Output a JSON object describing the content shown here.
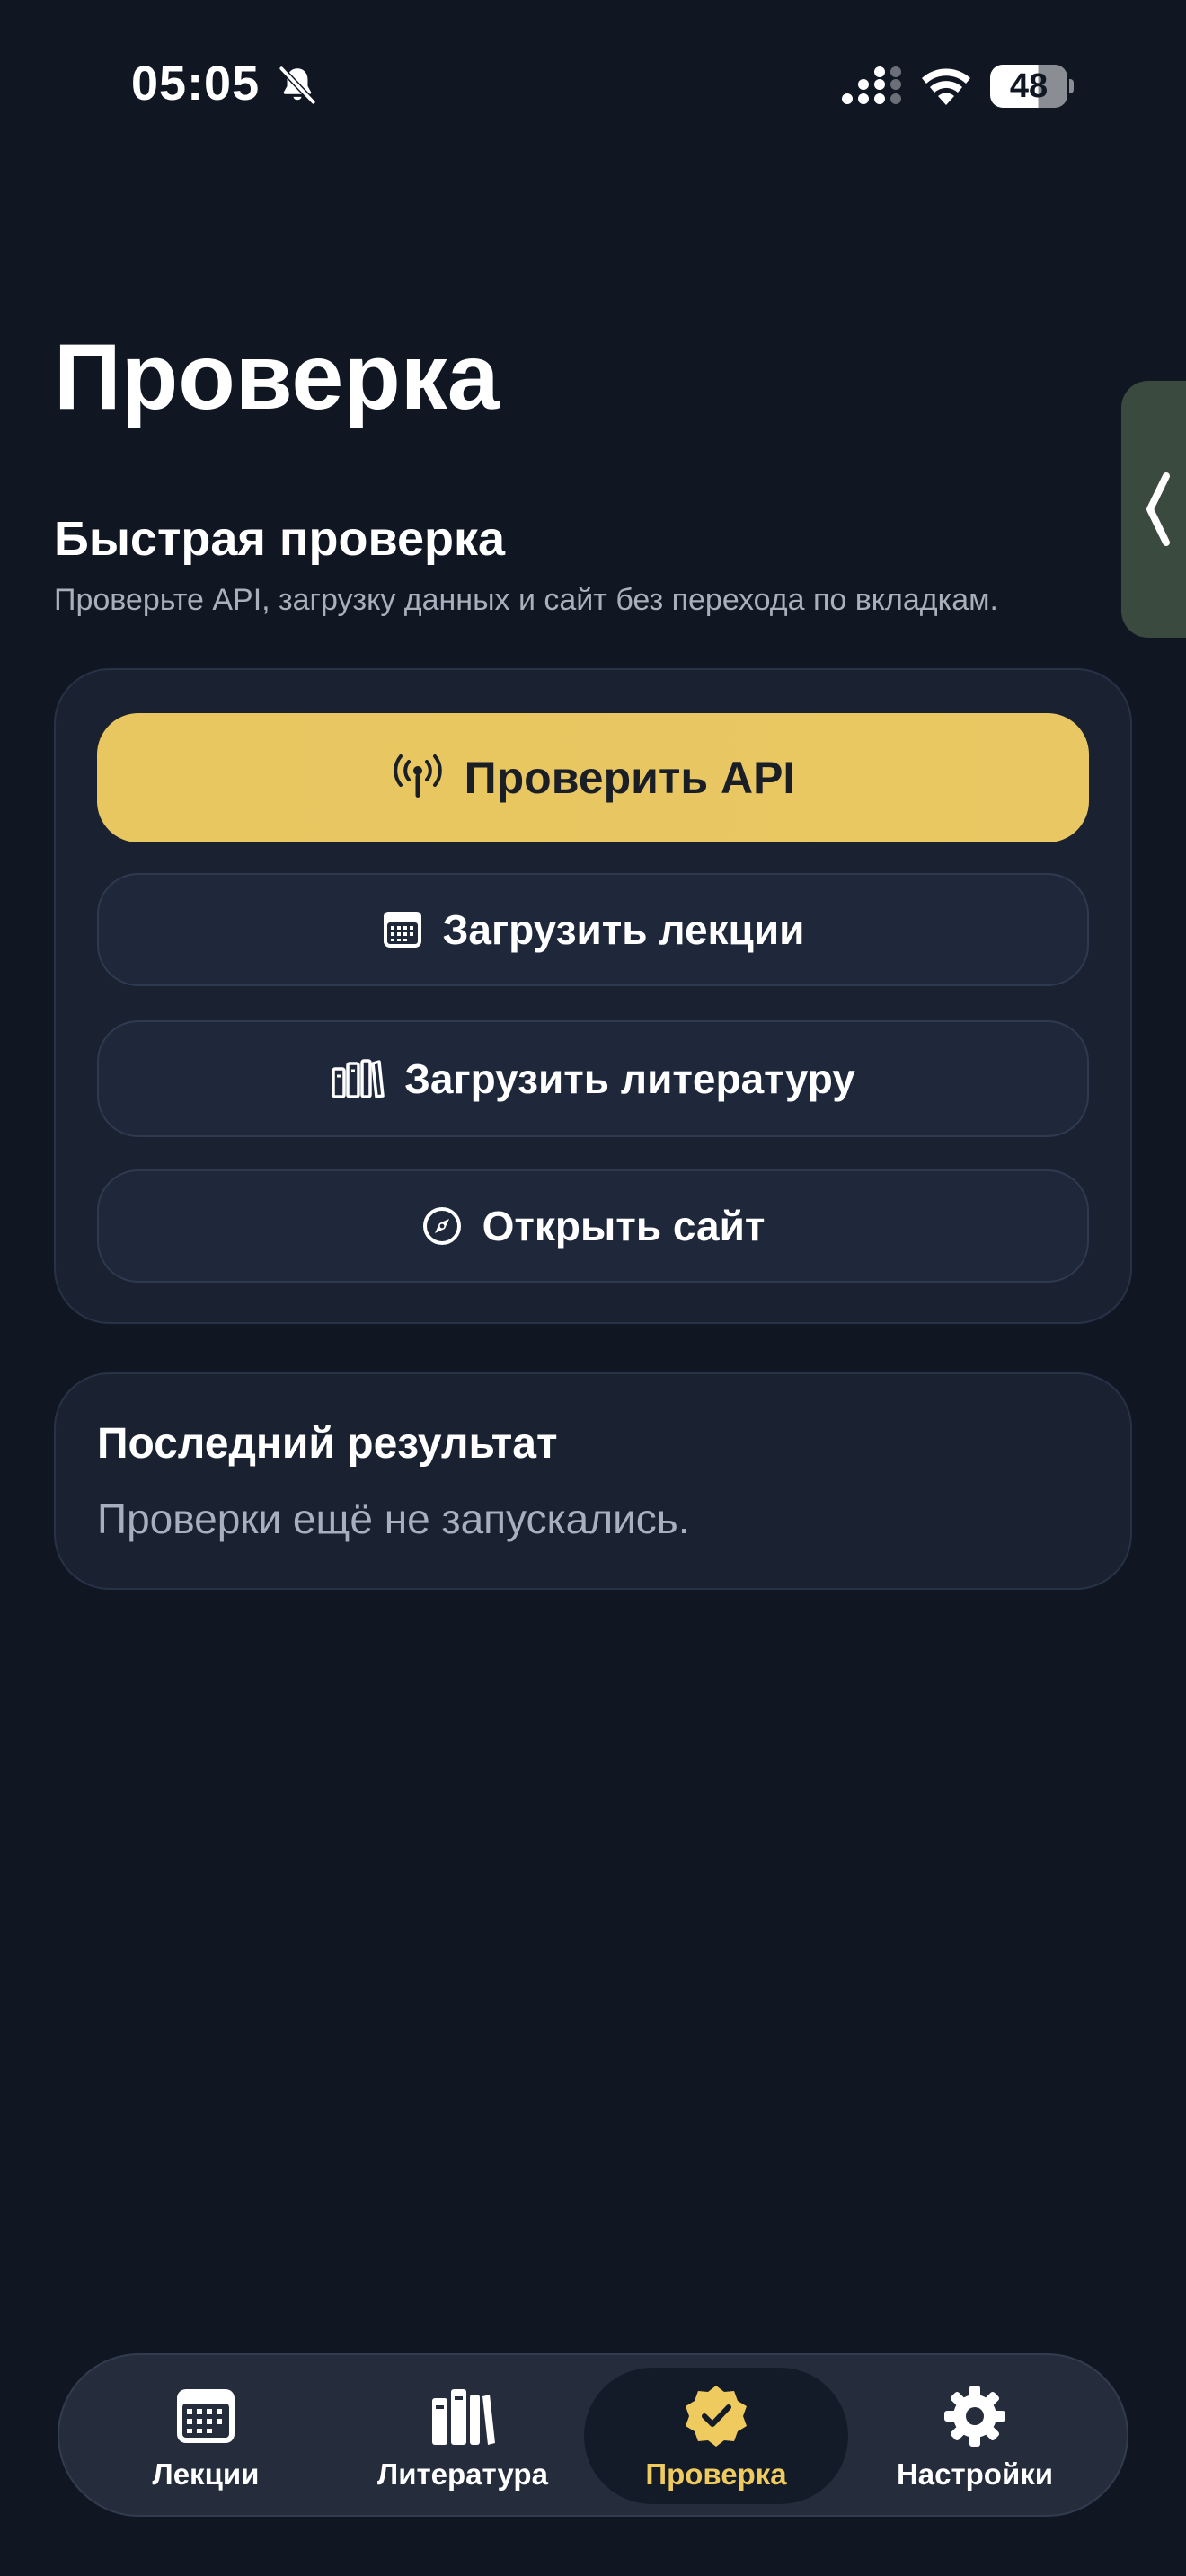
{
  "status_bar": {
    "time": "05:05",
    "battery": "48",
    "icons": [
      "bell-off-icon",
      "cellular-signal-icon",
      "wifi-icon",
      "battery-icon"
    ]
  },
  "page": {
    "title": "Проверка"
  },
  "quick_check": {
    "title": "Быстрая проверка",
    "subtitle": "Проверьте API, загрузку данных и сайт без перехода по вкладкам.",
    "buttons": [
      {
        "label": "Проверить API",
        "icon": "antenna-icon"
      },
      {
        "label": "Загрузить лекции",
        "icon": "calendar-icon"
      },
      {
        "label": "Загрузить литературу",
        "icon": "books-icon"
      },
      {
        "label": "Открыть сайт",
        "icon": "compass-icon"
      }
    ]
  },
  "last_result": {
    "title": "Последний результат",
    "text": "Проверки ещё не запускались."
  },
  "tabs": [
    {
      "label": "Лекции",
      "icon": "calendar-icon"
    },
    {
      "label": "Литература",
      "icon": "books-icon"
    },
    {
      "label": "Проверка",
      "icon": "verified-badge-icon",
      "active": true
    },
    {
      "label": "Настройки",
      "icon": "gear-icon"
    }
  ],
  "colors": {
    "background": "#111722",
    "card": "#1a2232",
    "accent": "#e8c660",
    "muted_text": "#a8b0bd"
  }
}
